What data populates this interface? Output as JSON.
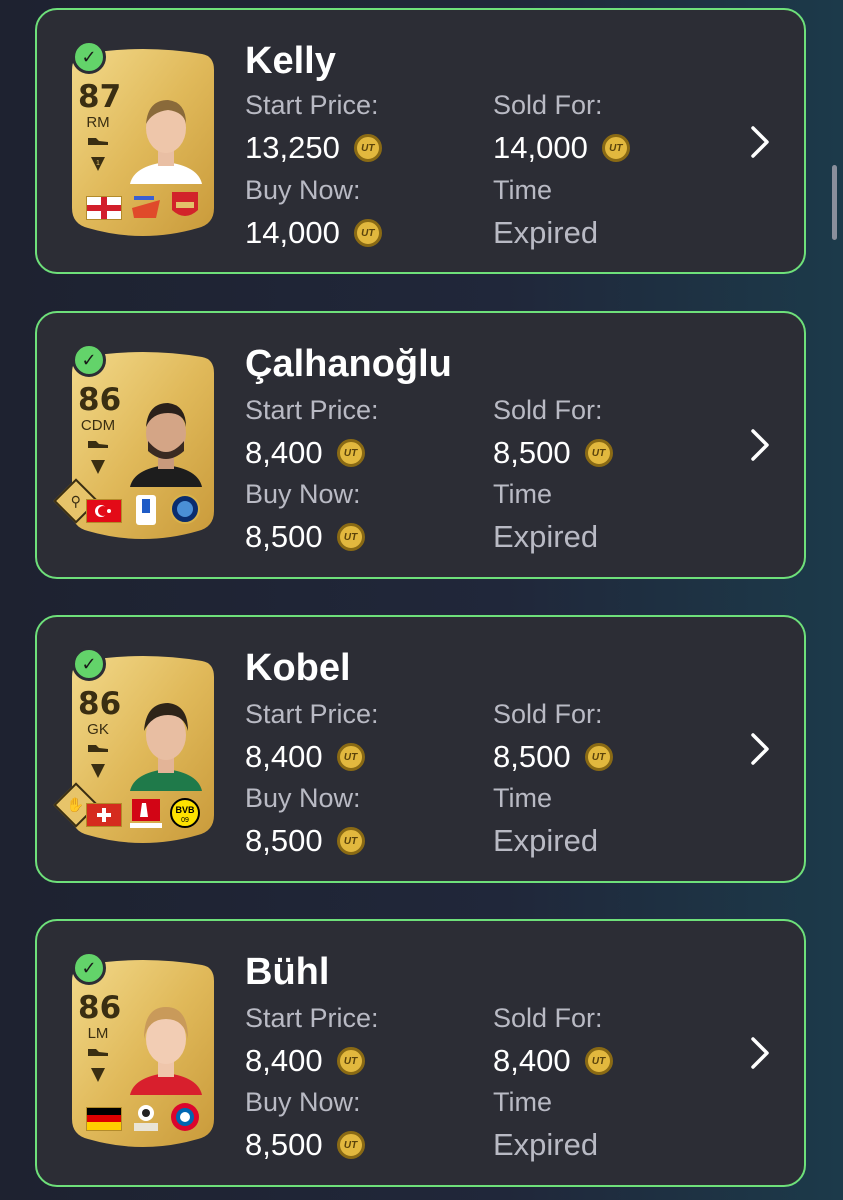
{
  "labels": {
    "start_price": "Start Price:",
    "buy_now": "Buy Now:",
    "sold_for": "Sold For:",
    "time": "Time",
    "coin_symbol": "UT"
  },
  "items": [
    {
      "name": "Kelly",
      "rating": "87",
      "position": "RM",
      "start_price": "13,250",
      "buy_now": "14,000",
      "sold_for": "14,000",
      "time_value": "Expired",
      "has_chem_icon": false,
      "flag": "england",
      "league": "Barclays WSL",
      "club": "Arsenal"
    },
    {
      "name": "Çalhanoğlu",
      "rating": "86",
      "position": "CDM",
      "start_price": "8,400",
      "buy_now": "8,500",
      "sold_for": "8,500",
      "time_value": "Expired",
      "has_chem_icon": true,
      "flag": "turkey",
      "league": "Serie A",
      "club": "Inter"
    },
    {
      "name": "Kobel",
      "rating": "86",
      "position": "GK",
      "start_price": "8,400",
      "buy_now": "8,500",
      "sold_for": "8,500",
      "time_value": "Expired",
      "has_chem_icon": true,
      "flag": "switzerland",
      "league": "Bundesliga",
      "club": "BVB 09"
    },
    {
      "name": "Bühl",
      "rating": "86",
      "position": "LM",
      "start_price": "8,400",
      "buy_now": "8,500",
      "sold_for": "8,400",
      "time_value": "Expired",
      "has_chem_icon": false,
      "flag": "germany",
      "league": "Google Pixel Frauen-Bundesliga",
      "club": "FC Bayern München"
    }
  ],
  "colors": {
    "background": "#1e2230",
    "panel": "#2c2d35",
    "panel_border": "#6ee07a",
    "card_gold": "#e7c46a",
    "coin_gold": "#e2b83e",
    "label_gray": "#b9bac4"
  },
  "icons": [
    "check-icon",
    "coin-icon",
    "chevron-right-icon",
    "boot-icon",
    "chemistry-style-icon"
  ]
}
